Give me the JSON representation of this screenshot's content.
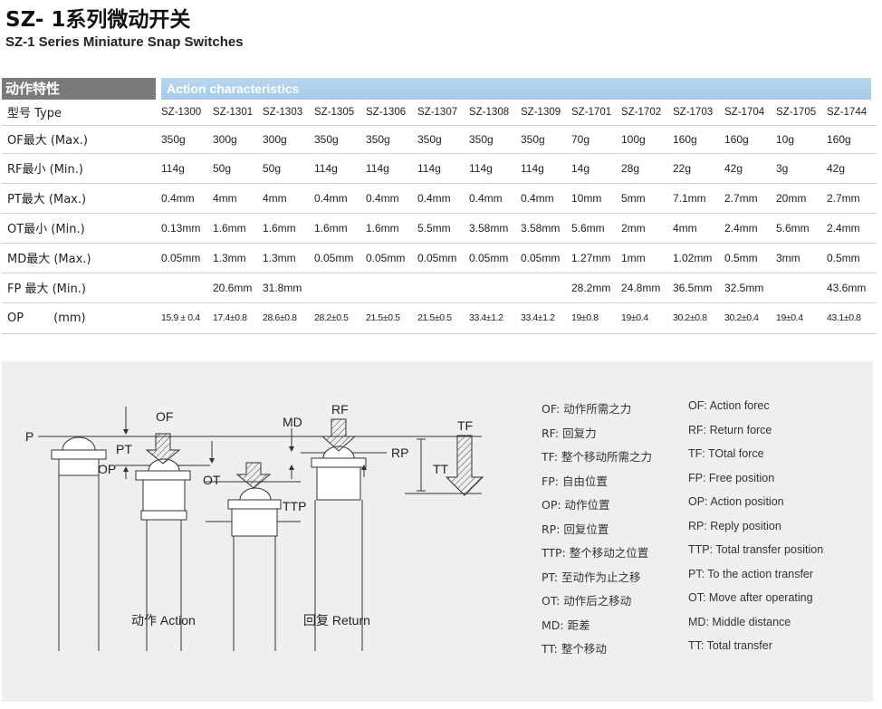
{
  "title_zh": "SZ- 1系列微动开关",
  "title_en": "SZ-1 Series Miniature Snap Switches",
  "table": {
    "header_left": "动作特性",
    "header_right": "Action characteristics",
    "type_label": "型号 Type",
    "models": [
      "SZ-1300",
      "SZ-1301",
      "SZ-1303",
      "SZ-1305",
      "SZ-1306",
      "SZ-1307",
      "SZ-1308",
      "SZ-1309",
      "SZ-1701",
      "SZ-1702",
      "SZ-1703",
      "SZ-1704",
      "SZ-1705",
      "SZ-1744"
    ],
    "rows": [
      {
        "label": "OF最大 (Max.)",
        "values": [
          "350g",
          "300g",
          "300g",
          "350g",
          "350g",
          "350g",
          "350g",
          "350g",
          "70g",
          "100g",
          "160g",
          "160g",
          "10g",
          "160g"
        ]
      },
      {
        "label": "RF最小 (Min.)",
        "values": [
          "114g",
          "50g",
          "50g",
          "114g",
          "114g",
          "114g",
          "114g",
          "114g",
          "14g",
          "28g",
          "22g",
          "42g",
          "3g",
          "42g"
        ]
      },
      {
        "label": "PT最大 (Max.)",
        "values": [
          "0.4mm",
          "4mm",
          "4mm",
          "0.4mm",
          "0.4mm",
          "0.4mm",
          "0.4mm",
          "0.4mm",
          "10mm",
          "5mm",
          "7.1mm",
          "2.7mm",
          "20mm",
          "2.7mm"
        ]
      },
      {
        "label": "OT最小 (Min.)",
        "values": [
          "0.13mm",
          "1.6mm",
          "1.6mm",
          "1.6mm",
          "1.6mm",
          "5.5mm",
          "3.58mm",
          "3.58mm",
          "5.6mm",
          "2mm",
          "4mm",
          "2.4mm",
          "5.6mm",
          "2.4mm"
        ]
      },
      {
        "label": "MD最大 (Max.)",
        "values": [
          "0.05mm",
          "1.3mm",
          "1.3mm",
          "0.05mm",
          "0.05mm",
          "0.05mm",
          "0.05mm",
          "0.05mm",
          "1.27mm",
          "1mm",
          "1.02mm",
          "0.5mm",
          "3mm",
          "0.5mm"
        ]
      },
      {
        "label": "FP 最大 (Min.)",
        "values": [
          "",
          "20.6mm",
          "31.8mm",
          "",
          "",
          "",
          "",
          "",
          "28.2mm",
          "24.8mm",
          "36.5mm",
          "32.5mm",
          "",
          "43.6mm"
        ]
      },
      {
        "label": "OP        (mm)",
        "values": [
          "15.9 ± 0.4",
          "17.4±0.8",
          "28.6±0.8",
          "28.2±0.5",
          "21.5±0.5",
          "21.5±0.5",
          "33.4±1.2",
          "33.4±1.2",
          "19±0.8",
          "19±0.4",
          "30.2±0.8",
          "30.2±0.4",
          "19±0.4",
          "43.1±0.8"
        ]
      }
    ]
  },
  "diagram": {
    "labels": {
      "P": "P",
      "OF": "OF",
      "PT": "PT",
      "OP": "OP",
      "OT": "OT",
      "MD": "MD",
      "RF": "RF",
      "RP": "RP",
      "TF": "TF",
      "TT": "TT",
      "TTP": "TTP"
    },
    "caption_action": "动作 Action",
    "caption_return": "回复 Return"
  },
  "legend_zh": [
    "OF: 动作所需之力",
    "RF: 回复力",
    "TF: 整个移动所需之力",
    "FP: 自由位置",
    "OP: 动作位置",
    "RP: 回复位置",
    "TTP: 整个移动之位置",
    "PT: 至动作为止之移",
    "OT: 动作后之移动",
    "MD: 距差",
    "TT: 整个移动"
  ],
  "legend_en": [
    "OF: Action forec",
    "RF: Return force",
    "TF: TOtal force",
    "FP: Free position",
    "OP: Action position",
    "RP: Reply position",
    "TTP: Total transfer position",
    "PT: To the action transfer",
    "OT: Move after operating",
    "MD: Middle distance",
    "TT: Total transfer"
  ]
}
